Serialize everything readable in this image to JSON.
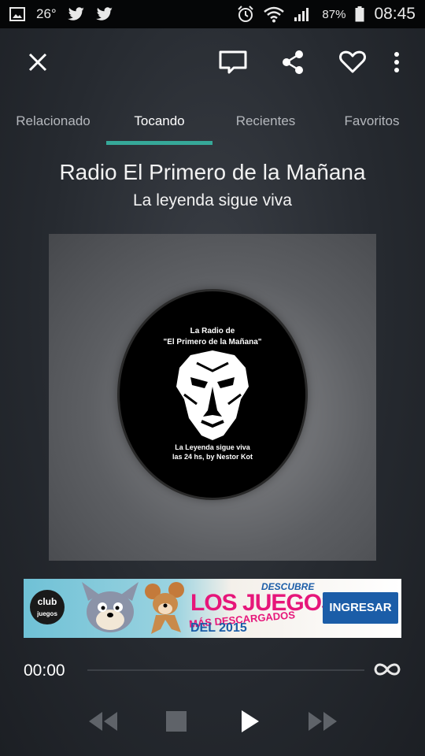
{
  "status_bar": {
    "temperature": "26°",
    "battery": "87%",
    "time": "08:45",
    "icons": [
      "gallery-icon",
      "twitter-icon",
      "twitter-icon",
      "alarm-icon",
      "wifi-icon",
      "signal-icon",
      "battery-icon"
    ]
  },
  "toolbar": {
    "icons": [
      "close-icon",
      "cast-icon",
      "share-icon",
      "heart-icon",
      "more-vert-icon"
    ]
  },
  "tabs": [
    {
      "label": "Relacionado",
      "active": false
    },
    {
      "label": "Tocando",
      "active": true
    },
    {
      "label": "Recientes",
      "active": false
    },
    {
      "label": "Favoritos",
      "active": false
    }
  ],
  "station": {
    "name": "Radio El Primero de la Mañana",
    "slogan": "La leyenda sigue viva"
  },
  "artwork": {
    "line1": "La Radio de",
    "line2": "\"El Primero de la Mañana\"",
    "line3": "La Leyenda sigue viva",
    "line4": "las 24 hs, by Nestor Kot"
  },
  "ad": {
    "club": "club",
    "club_sub": "juegos",
    "descubre": "DESCUBRE",
    "headline": "LOS JUEGOS",
    "sub": "MÁS DESCARGADOS",
    "year": "DEL 2015",
    "cta": "INGRESAR"
  },
  "player": {
    "current_time": "00:00",
    "progress": 0,
    "duration_icon": "infinity-icon",
    "controls": [
      "rewind-icon",
      "stop-icon",
      "play-icon",
      "fast-forward-icon"
    ]
  },
  "colors": {
    "accent": "#36a899",
    "background": "#262a30",
    "status_bar": "#050607"
  }
}
